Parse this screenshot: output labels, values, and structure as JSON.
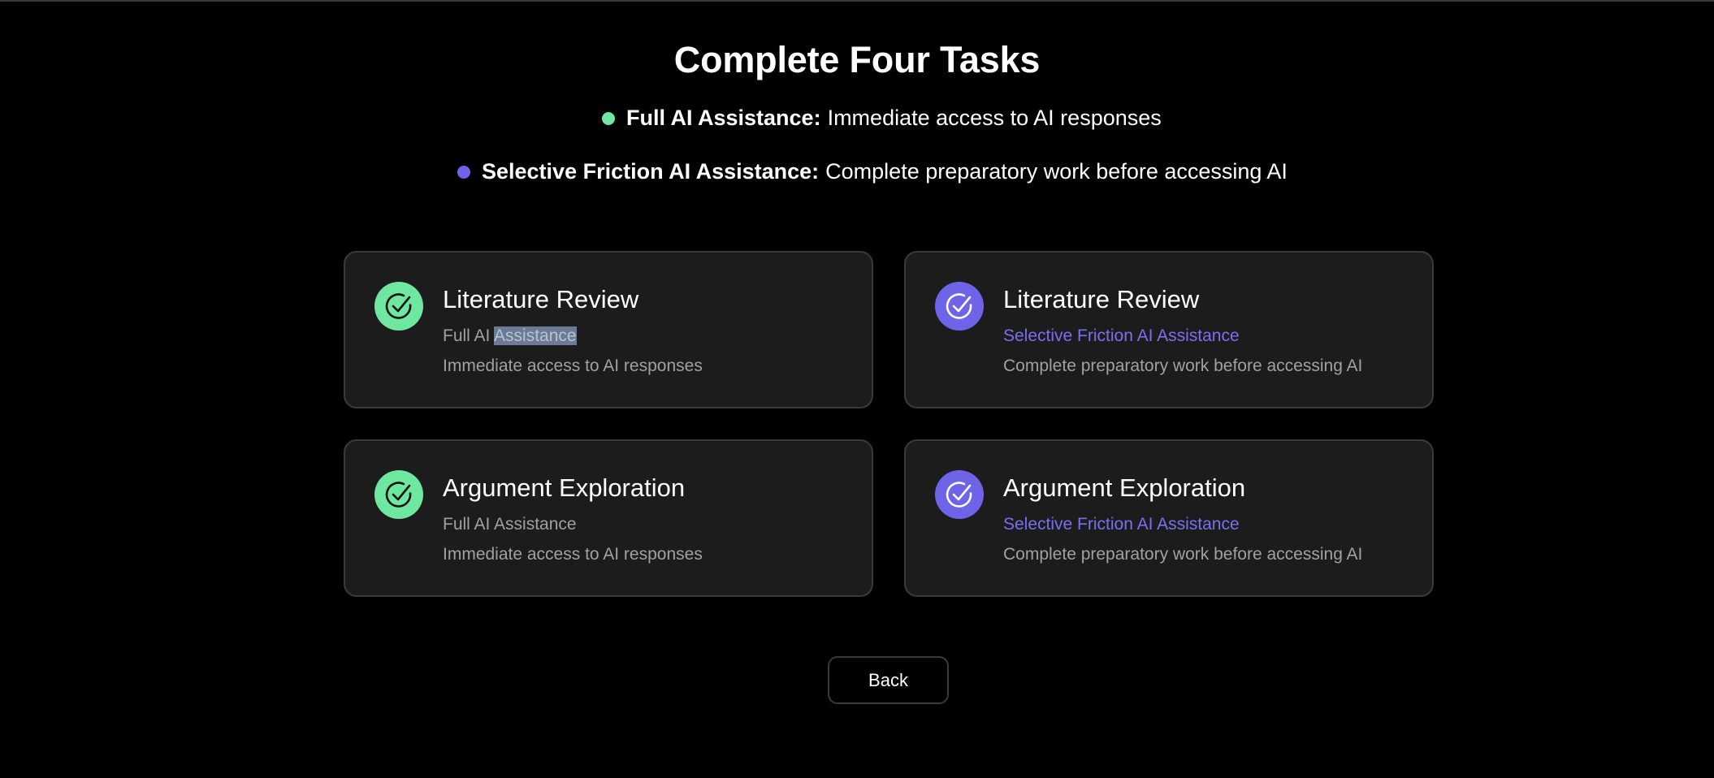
{
  "title": "Complete Four Tasks",
  "legend": [
    {
      "label": "Full AI Assistance:",
      "description": "Immediate access to AI responses",
      "color": "#6ee7a0"
    },
    {
      "label": "Selective Friction AI Assistance:",
      "description": "Complete preparatory work before accessing AI",
      "color": "#6f63e8"
    }
  ],
  "tasks": [
    {
      "title": "Literature Review",
      "mode_part1": "Full AI ",
      "mode_part2": "Assistance",
      "description": "Immediate access to AI responses",
      "icon": "check-circle-icon",
      "accent": "#6ee7a0",
      "mode_color": "#a0a0a5"
    },
    {
      "title": "Literature Review",
      "mode": "Selective Friction AI Assistance",
      "description": "Complete preparatory work before accessing AI",
      "icon": "check-circle-icon",
      "accent": "#6f63e8",
      "mode_color": "#7a6ff0"
    },
    {
      "title": "Argument Exploration",
      "mode": "Full AI Assistance",
      "description": "Immediate access to AI responses",
      "icon": "check-circle-icon",
      "accent": "#6ee7a0",
      "mode_color": "#a0a0a5"
    },
    {
      "title": "Argument Exploration",
      "mode": "Selective Friction AI Assistance",
      "description": "Complete preparatory work before accessing AI",
      "icon": "check-circle-icon",
      "accent": "#6f63e8",
      "mode_color": "#7a6ff0"
    }
  ],
  "back_label": "Back"
}
